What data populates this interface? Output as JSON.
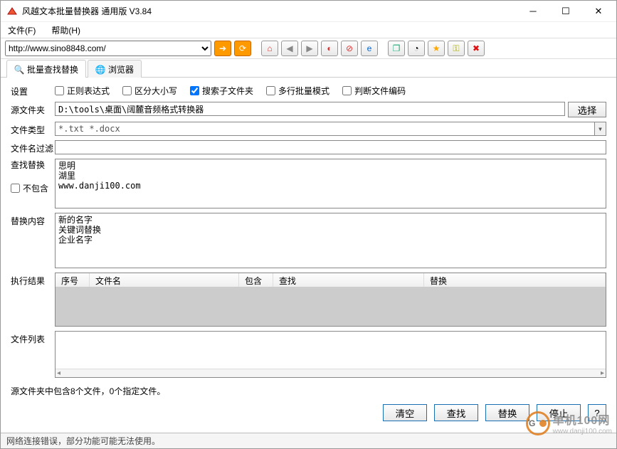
{
  "window": {
    "title": "风越文本批量替换器 通用版 V3.84"
  },
  "menu": {
    "file": "文件(F)",
    "help": "帮助(H)"
  },
  "address": {
    "url": "http://www.sino8848.com/"
  },
  "tabs": {
    "batch": "批量查找替换",
    "browser": "浏览器"
  },
  "labels": {
    "settings": "设置",
    "srcfolder": "源文件夹",
    "filetype": "文件类型",
    "filter": "文件名过滤",
    "findreplace": "查找替换",
    "notinclude": "不包含",
    "replacecontent": "替换内容",
    "result": "执行结果",
    "filelist": "文件列表"
  },
  "checks": {
    "regex": "正则表达式",
    "case": "区分大小写",
    "sub": "搜索子文件夹",
    "multi": "多行批量模式",
    "encoding": "判断文件编码"
  },
  "values": {
    "srcfolder": "D:\\tools\\桌面\\阔麓音频格式转换器",
    "filetype": "*.txt *.docx",
    "filter": "",
    "find": "思明\n湖里\nwww.danji100.com",
    "replace": "新的名字\n关键词替换\n企业名字"
  },
  "grid": {
    "col1": "序号",
    "col2": "文件名",
    "col3": "包含",
    "col4": "查找",
    "col5": "替换"
  },
  "buttons": {
    "select": "选择",
    "clear": "清空",
    "find": "查找",
    "replace": "替换",
    "stop": "停止",
    "help": "?"
  },
  "status": {
    "summary": "源文件夹中包含8个文件，0个指定文件。",
    "footer": "网络连接错误，部分功能可能无法使用。"
  },
  "watermark": {
    "text": "单机100网",
    "sub": "www.danji100.com"
  }
}
